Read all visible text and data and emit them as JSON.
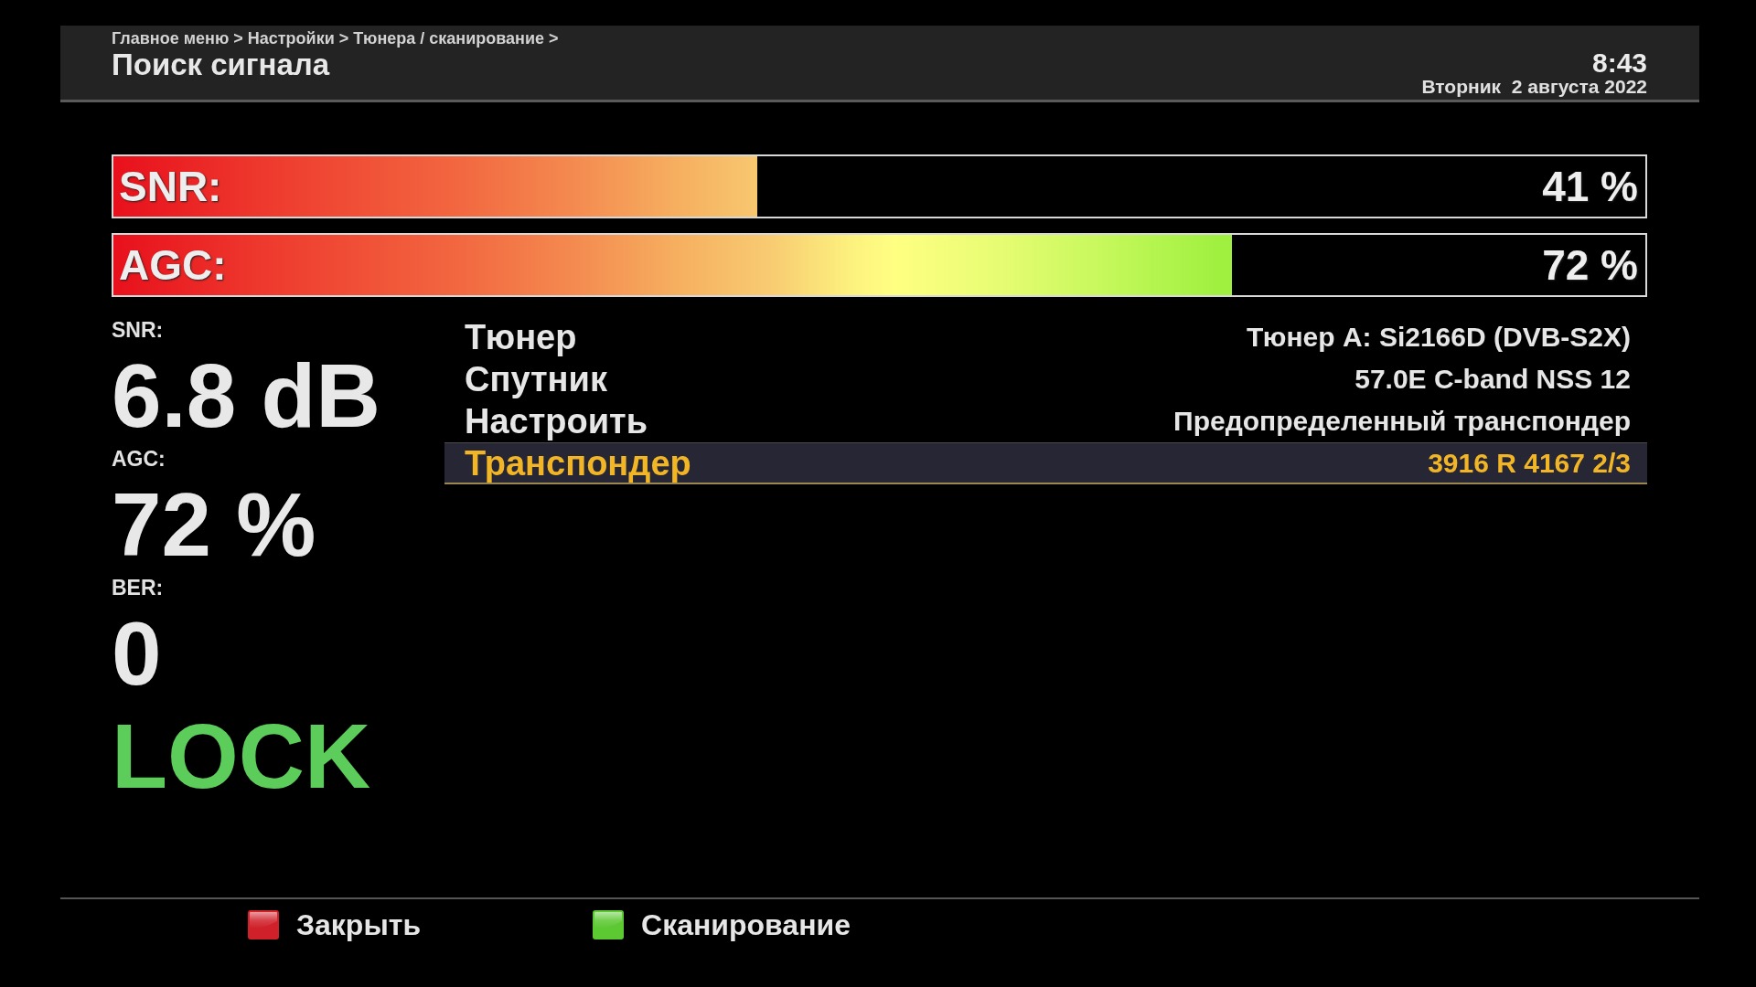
{
  "header": {
    "breadcrumb": "Главное меню > Настройки > Тюнера / сканирование >",
    "title": "Поиск сигнала",
    "time": "8:43",
    "date": "Вторник  2 августа 2022"
  },
  "meters": [
    {
      "label": "SNR:",
      "level": 0.42,
      "reading": "41 %"
    },
    {
      "label": "AGC:",
      "level": 0.73,
      "reading": "72 %"
    }
  ],
  "stats": [
    {
      "label": "SNR:",
      "value": "6.8 dB"
    },
    {
      "label": "AGC:",
      "value": "72 %"
    },
    {
      "label": "BER:",
      "value": "0"
    }
  ],
  "lock": {
    "text": "LOCK",
    "locked": true
  },
  "info_rows": [
    {
      "label": "Тюнер",
      "value": "Тюнер A: Si2166D (DVB-S2X)",
      "selected": false
    },
    {
      "label": "Спутник",
      "value": "57.0E C-band NSS 12",
      "selected": false
    },
    {
      "label": "Настроить",
      "value": "Предопределенный транспондер",
      "selected": false
    },
    {
      "label": "Транспондер",
      "value": "3916 R 4167 2/3",
      "selected": true
    }
  ],
  "footer_buttons": [
    {
      "label": "Закрыть",
      "color": "#d0202a"
    },
    {
      "label": "Сканирование",
      "color": "#5cc832"
    }
  ]
}
